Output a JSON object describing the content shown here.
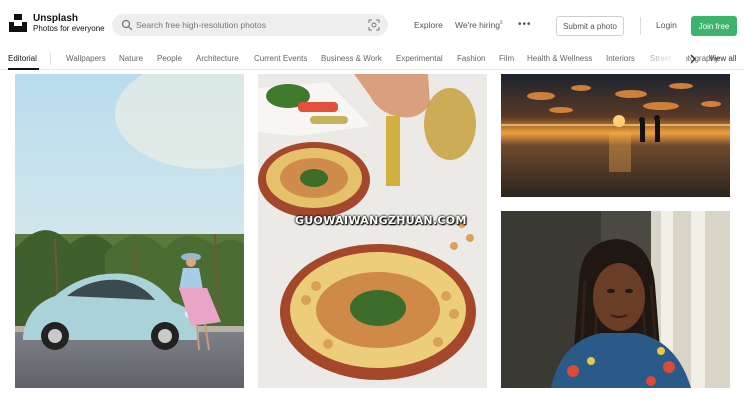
{
  "header": {
    "brand_name": "Unsplash",
    "brand_tagline": "Photos for everyone",
    "search_placeholder": "Search free high-resolution photos",
    "nav_explore": "Explore",
    "nav_hiring": "We're hiring",
    "nav_hiring_badge": "6",
    "more_glyph": "•••",
    "submit_label": "Submit a photo",
    "login_label": "Login",
    "join_label": "Join free",
    "accent_color": "#3cb46e"
  },
  "categories": {
    "active": "Editorial",
    "items": [
      "Wallpapers",
      "Nature",
      "People",
      "Architecture",
      "Current Events",
      "Business & Work",
      "Experimental",
      "Fashion",
      "Film",
      "Health & Wellness",
      "Interiors",
      "Street Photography"
    ],
    "view_all": "View all"
  },
  "watermark": "GUOWAIWANGZHUAN.COM"
}
